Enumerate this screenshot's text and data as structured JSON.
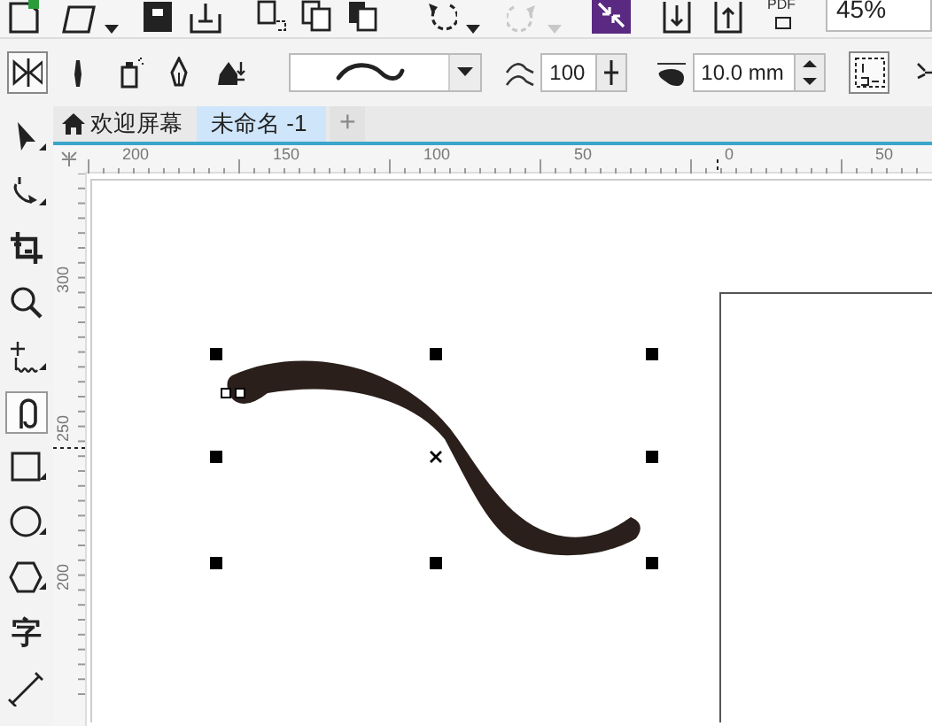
{
  "standard_toolbar": {
    "pdf_label": "PDF",
    "zoom": "45%",
    "redo_disabled": true
  },
  "property_bar": {
    "modes": [
      {
        "selected": true
      },
      {
        "selected": false
      },
      {
        "selected": false
      },
      {
        "selected": false
      },
      {
        "selected": false
      }
    ],
    "smoothing": "100",
    "stroke_width": "10.0 mm"
  },
  "toolbox": {
    "tools": [
      {
        "kind": "pick",
        "selected": false
      },
      {
        "kind": "shape",
        "selected": false
      },
      {
        "kind": "crop",
        "selected": false
      },
      {
        "kind": "zoom",
        "selected": false
      },
      {
        "kind": "freehand",
        "selected": false
      },
      {
        "kind": "media",
        "selected": true
      },
      {
        "kind": "rectangle",
        "selected": false
      },
      {
        "kind": "ellipse",
        "selected": false
      },
      {
        "kind": "polygon",
        "selected": false
      },
      {
        "kind": "text",
        "label": "字",
        "selected": false
      },
      {
        "kind": "line",
        "selected": false
      }
    ]
  },
  "document_tabs": [
    {
      "label": "欢迎屏幕",
      "home": true,
      "selected": false
    },
    {
      "label": "未命名 -1",
      "home": false,
      "selected": true
    }
  ],
  "new_tab": "+",
  "rulers": {
    "horizontal": [
      "200",
      "150",
      "100",
      "50",
      "0",
      "50"
    ],
    "vertical": [
      "300",
      "250",
      "200"
    ]
  }
}
